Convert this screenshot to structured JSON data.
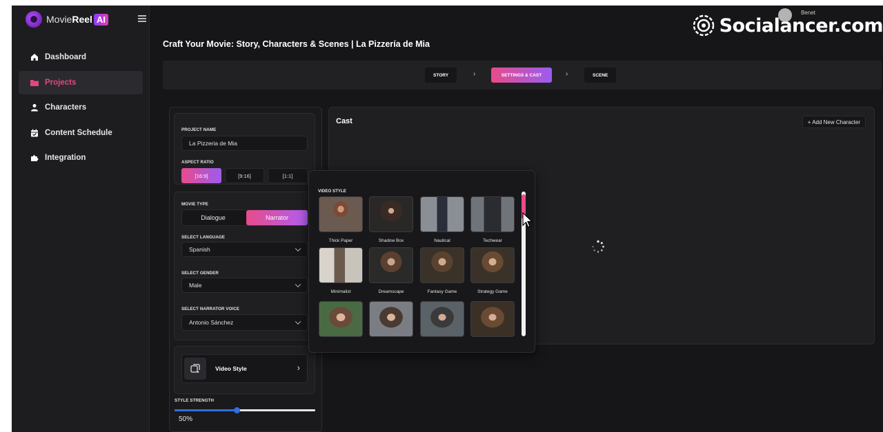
{
  "app": {
    "logo_prefix": "Movie",
    "logo_bold": "Reel",
    "logo_ai": "AI"
  },
  "sidebar": {
    "items": [
      {
        "label": "Dashboard",
        "icon": "home-icon"
      },
      {
        "label": "Projects",
        "icon": "folder-icon",
        "active": true
      },
      {
        "label": "Characters",
        "icon": "user-icon"
      },
      {
        "label": "Content Schedule",
        "icon": "calendar-icon"
      },
      {
        "label": "Integration",
        "icon": "puzzle-icon"
      }
    ]
  },
  "header": {
    "user_name": "Benet",
    "watermark": "Socialancer.com"
  },
  "page": {
    "title": "Craft Your Movie: Story, Characters & Scenes | La Pizzería de Mia"
  },
  "stepper": {
    "steps": [
      {
        "label": "STORY"
      },
      {
        "label": "SETTINGS & CAST",
        "active": true
      },
      {
        "label": "SCENE"
      }
    ]
  },
  "settings": {
    "project_name_label": "PROJECT NAME",
    "project_name_value": "La Pizzeria de Mia",
    "aspect_ratio_label": "ASPECT RATIO",
    "aspect_ratios": [
      "[16:9]",
      "[9:16]",
      "[1:1]"
    ],
    "movie_type_label": "MOVIE TYPE",
    "movie_types": [
      "Dialogue",
      "Narrator"
    ],
    "language_label": "SELECT LANGUAGE",
    "language_value": "Spanish",
    "gender_label": "SELECT GENDER",
    "gender_value": "Male",
    "voice_label": "SELECT NARRATOR VOICE",
    "voice_value": "Antonio Sánchez",
    "video_style_label": "Video Style",
    "style_strength_label": "STYLE STRENGTH",
    "style_strength_value": "50%",
    "style_strength_fraction": 0.44
  },
  "cast": {
    "title": "Cast",
    "add_button": "+ Add New Character"
  },
  "video_style_popup": {
    "label": "VIDEO STYLE",
    "styles": [
      "Thick Paper",
      "Shadow Box",
      "Nautical",
      "Techwear",
      "Minimalist",
      "Dreamscape",
      "Fantasy Game",
      "Strategy Game",
      "",
      "",
      "",
      ""
    ]
  },
  "colors": {
    "accent_pink": "#e84b8a",
    "accent_purple": "#9b5cf0",
    "slider_blue": "#2f6fde",
    "background": "#161618"
  }
}
